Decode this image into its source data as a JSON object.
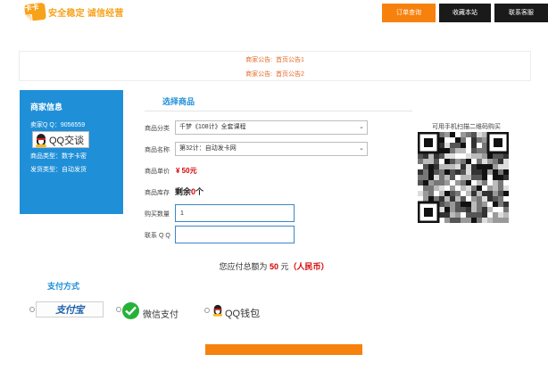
{
  "header": {
    "logo_mark": "卡卡网",
    "logo_text": "安全稳定 诚信经营",
    "nav": [
      {
        "label": "订单查询",
        "active": true
      },
      {
        "label": "收藏本站",
        "active": false
      },
      {
        "label": "联系客服",
        "active": false
      }
    ]
  },
  "notice": {
    "lines": [
      {
        "prefix": "商家公告:",
        "text": "首页公告1"
      },
      {
        "prefix": "商家公告:",
        "text": "首页公告2"
      }
    ]
  },
  "merchant": {
    "title": "商家信息",
    "qq": "卖家Q Q：9056559",
    "qq_button": "QQ交谈",
    "product_type": "商品类型：数字卡密",
    "delivery_type": "发货类型：自动发货"
  },
  "product": {
    "title": "选择商品",
    "category_label": "商品分类",
    "category_value": "千梦《108计》全套课程",
    "name_label": "商品名称",
    "name_value": "第32计：自动发卡网",
    "price_label": "商品单价",
    "price_value": "¥ 50元",
    "stock_label": "商品库存",
    "stock_prefix": "剩余",
    "stock_num": "0",
    "stock_unit": "个",
    "quantity_label": "购买数量",
    "quantity_value": "1",
    "contact_label": "联系 Q Q",
    "contact_value": ""
  },
  "qr": {
    "caption": "可用手机扫描二维码购买"
  },
  "total": {
    "prefix": "您应付总额为",
    "amount": "50",
    "unit": "元",
    "currency": "（人民币）"
  },
  "payment": {
    "title": "支付方式",
    "alipay": "支付宝",
    "wechat": "微信支付",
    "qqpay": "QQ钱包"
  },
  "colors": {
    "accent_orange": "#f7810d",
    "brand_blue": "#1f8fd8",
    "price_red": "#d40000"
  }
}
